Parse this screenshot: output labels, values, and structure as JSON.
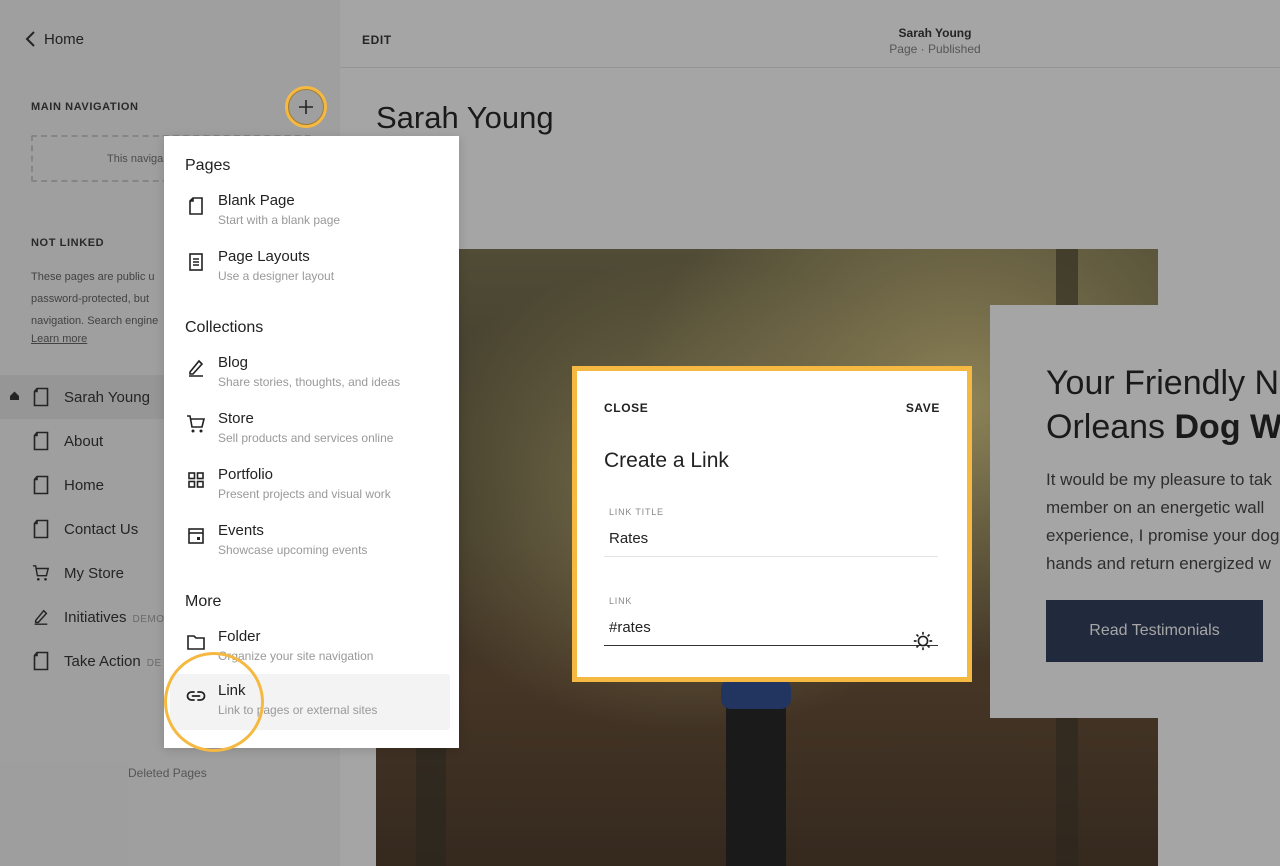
{
  "sidebar": {
    "back_label": "Home",
    "main_nav_title": "MAIN NAVIGATION",
    "nav_empty_text": "This naviga",
    "not_linked_title": "NOT LINKED",
    "not_linked_desc_lines": [
      "These pages are public u",
      "password-protected, but",
      "navigation. Search engine"
    ],
    "learn_more": "Learn more",
    "pages": [
      {
        "label": "Sarah Young",
        "icon": "page-icon",
        "badge": "",
        "home": true,
        "active": true
      },
      {
        "label": "About",
        "icon": "page-icon",
        "badge": ""
      },
      {
        "label": "Home",
        "icon": "page-icon",
        "badge": ""
      },
      {
        "label": "Contact Us",
        "icon": "page-icon",
        "badge": ""
      },
      {
        "label": "My Store",
        "icon": "cart-icon",
        "badge": ""
      },
      {
        "label": "Initiatives",
        "icon": "blog-icon",
        "badge": "DEMO"
      },
      {
        "label": "Take Action",
        "icon": "page-icon",
        "badge": "DE"
      }
    ],
    "deleted_pages": "Deleted Pages"
  },
  "topbar": {
    "edit": "EDIT",
    "title": "Sarah Young",
    "subtitle": "Page · Published"
  },
  "page": {
    "heading": "Sarah Young",
    "promo_title_line1": "Your Friendly N",
    "promo_title_line2_plain": "Orleans ",
    "promo_title_line2_bold": "Dog W",
    "promo_text_lines": [
      "It would be my pleasure to tak",
      "member on an energetic wall",
      "experience, I promise your dog",
      "hands and return energized w"
    ],
    "promo_button": "Read Testimonials"
  },
  "menu": {
    "groups": {
      "pages": "Pages",
      "collections": "Collections",
      "more": "More"
    },
    "items": [
      {
        "label": "Blank Page",
        "sub": "Start with a blank page",
        "icon": "blank-page-icon"
      },
      {
        "label": "Page Layouts",
        "sub": "Use a designer layout",
        "icon": "page-layouts-icon"
      },
      {
        "label": "Blog",
        "sub": "Share stories, thoughts, and ideas",
        "icon": "blog-icon"
      },
      {
        "label": "Store",
        "sub": "Sell products and services online",
        "icon": "cart-icon"
      },
      {
        "label": "Portfolio",
        "sub": "Present projects and visual work",
        "icon": "grid-icon"
      },
      {
        "label": "Events",
        "sub": "Showcase upcoming events",
        "icon": "calendar-icon"
      },
      {
        "label": "Folder",
        "sub": "Organize your site navigation",
        "icon": "folder-icon"
      },
      {
        "label": "Link",
        "sub": "Link to pages or external sites",
        "icon": "link-icon"
      }
    ]
  },
  "dialog": {
    "close": "CLOSE",
    "save": "SAVE",
    "title": "Create a Link",
    "link_title_label": "LINK TITLE",
    "link_title_value": "Rates",
    "link_label": "LINK",
    "link_value": "#rates"
  },
  "colors": {
    "highlight": "#f5b942",
    "button_navy": "#1c2a4a"
  }
}
